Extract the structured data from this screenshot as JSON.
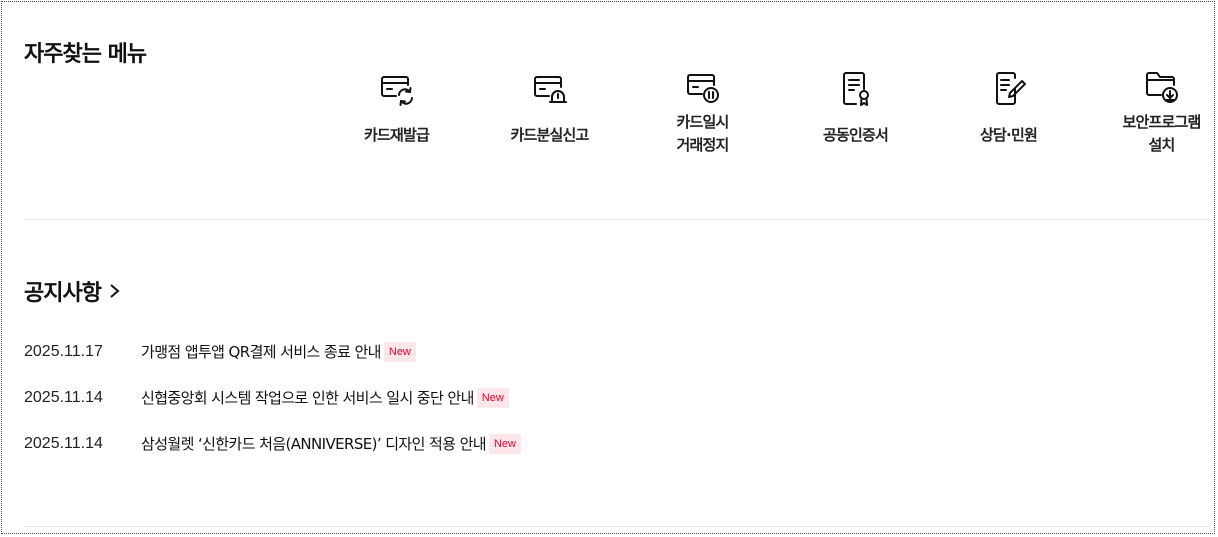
{
  "frequent_menu": {
    "title": "자주찾는 메뉴",
    "items": [
      {
        "label": "카드재발급",
        "icon": "card-reissue-icon"
      },
      {
        "label": "카드분실신고",
        "icon": "card-lost-report-icon"
      },
      {
        "label": "카드일시\n거래정지",
        "icon": "card-pause-icon"
      },
      {
        "label": "공동인증서",
        "icon": "certificate-icon"
      },
      {
        "label": "상담·민원",
        "icon": "consultation-icon"
      },
      {
        "label": "보안프로그램\n설치",
        "icon": "security-download-icon"
      }
    ]
  },
  "notices": {
    "title": "공지사항",
    "items": [
      {
        "date": "2025.11.17",
        "text": "가맹점 앱투앱 QR결제 서비스 종료 안내",
        "badge": "New"
      },
      {
        "date": "2025.11.14",
        "text": "신협중앙회 시스템 작업으로 인한 서비스 일시 중단 안내",
        "badge": "New"
      },
      {
        "date": "2025.11.14",
        "text": "삼성월렛 ‘신한카드 처음(ANNIVERSE)’ 디자인 적용 안내",
        "badge": "New"
      }
    ]
  },
  "colors": {
    "badge_text": "#e6002d",
    "badge_bg": "#fde7ea",
    "divider": "#e8e8e8"
  }
}
